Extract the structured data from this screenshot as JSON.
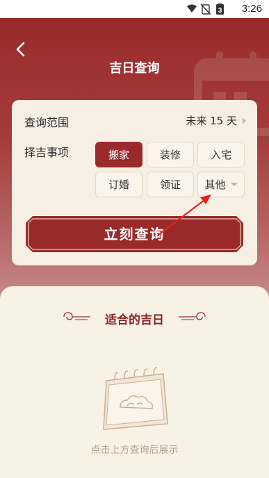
{
  "status_bar": {
    "time": "3:26",
    "battery": "3"
  },
  "header": {
    "title": "吉日查询"
  },
  "query": {
    "range_label": "查询范围",
    "range_value": "未来 15 天",
    "matter_label": "择吉事项",
    "options": [
      {
        "label": "搬家",
        "selected": true
      },
      {
        "label": "装修",
        "selected": false
      },
      {
        "label": "入宅",
        "selected": false
      },
      {
        "label": "订婚",
        "selected": false
      },
      {
        "label": "领证",
        "selected": false
      },
      {
        "label": "其他",
        "selected": false
      }
    ],
    "button_label": "立刻查询"
  },
  "result": {
    "title": "适合的吉日",
    "empty_hint": "点击上方查询后展示"
  },
  "colors": {
    "brand_red": "#9a2a2a",
    "card_bg": "#f7efe4",
    "annotation_arrow": "#e8201e"
  }
}
